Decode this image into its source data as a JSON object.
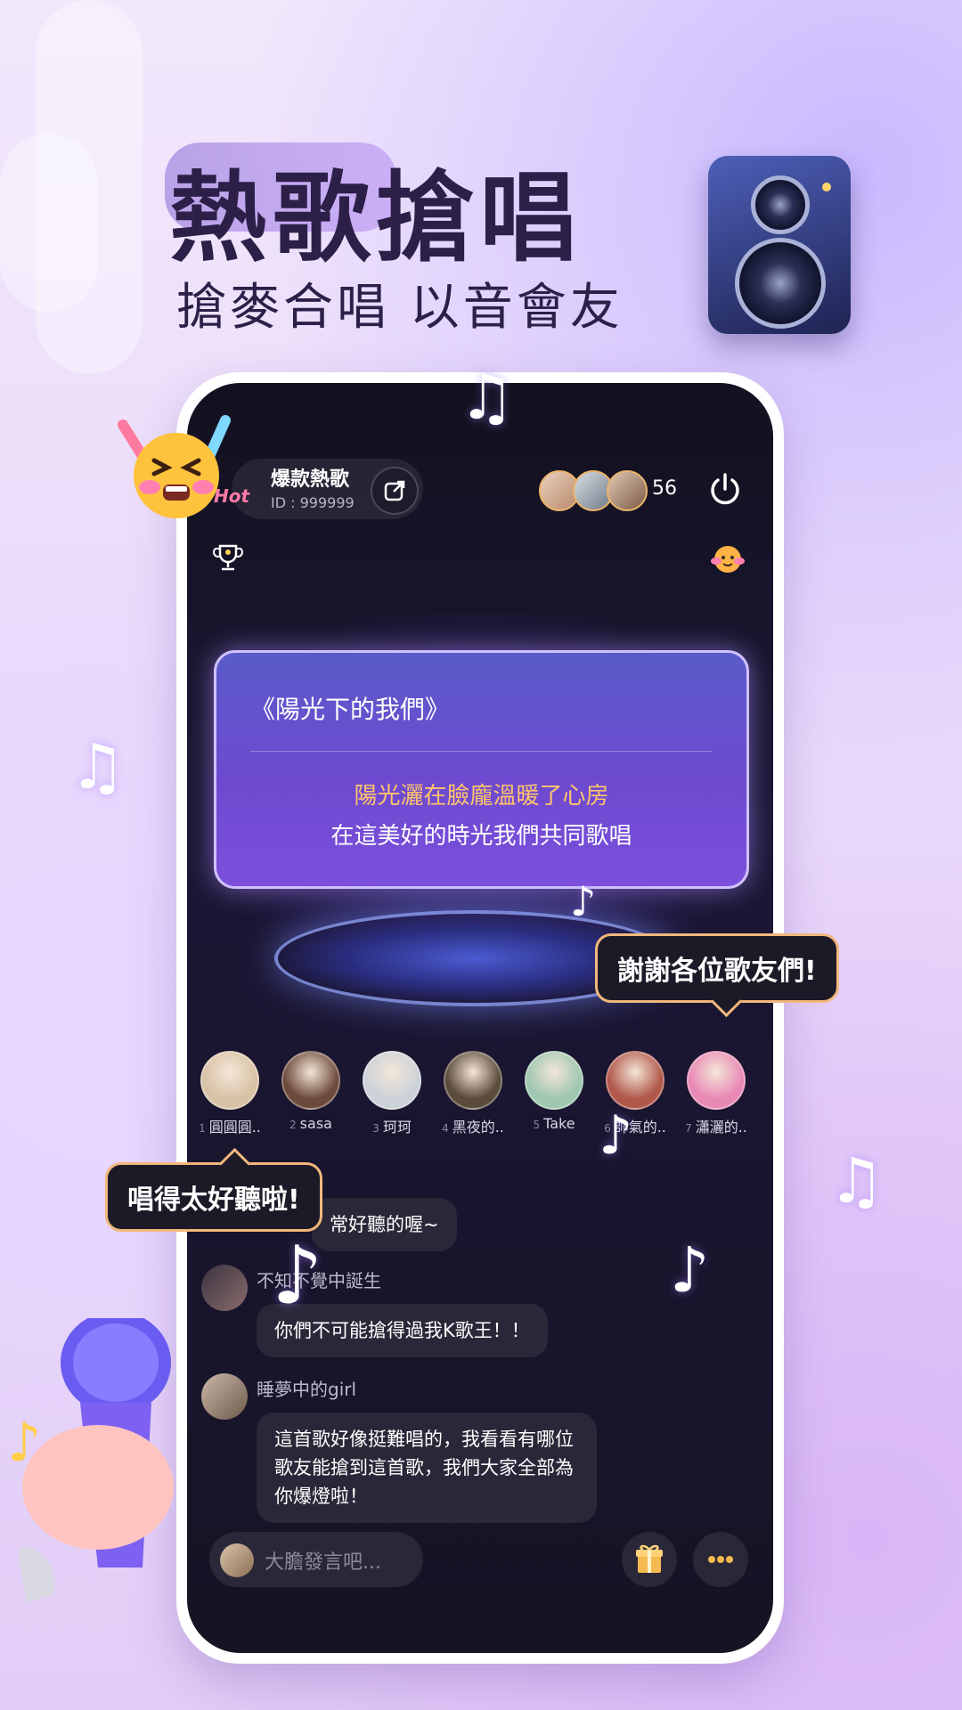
{
  "promo": {
    "headline": "熱歌搶唱",
    "subheadline": "搶麥合唱 以音會友"
  },
  "room": {
    "logo_text": "Hot",
    "title": "爆款熱歌",
    "id_text": "ID : 999999",
    "online_count": "56"
  },
  "lyrics": {
    "song_title": "《陽光下的我們》",
    "line_current": "陽光灑在臉龐溫暖了心房",
    "line_next": "在這美好的時光我們共同歌唱"
  },
  "mic_seats": [
    {
      "num": "1",
      "name": "圓圓圓..",
      "color": "#d8c2a6"
    },
    {
      "num": "2",
      "name": "sasa",
      "color": "#6d4b3c"
    },
    {
      "num": "3",
      "name": "珂珂",
      "color": "#ccd2d8"
    },
    {
      "num": "4",
      "name": "黑夜的..",
      "color": "#5a4b3b"
    },
    {
      "num": "5",
      "name": "Take",
      "color": "#9fc7b1"
    },
    {
      "num": "6",
      "name": "帥氣的..",
      "color": "#b0584a"
    },
    {
      "num": "7",
      "name": "瀟灑的..",
      "color": "#e889b5"
    }
  ],
  "chat": [
    {
      "name": "",
      "text": "常好聽的喔~"
    },
    {
      "name": "不知不覺中誕生",
      "text": "你們不可能搶得過我K歌王！！"
    },
    {
      "name": "睡夢中的girl",
      "text": "這首歌好像挺難唱的，我看看有哪位歌友能搶到這首歌，我們大家全部為你爆燈啦！"
    }
  ],
  "input": {
    "placeholder": "大膽發言吧..."
  },
  "callouts": {
    "right": "謝謝各位歌友們!",
    "left": "唱得太好聽啦!"
  },
  "icons": [
    "share-icon",
    "power-icon",
    "trophy-icon",
    "gift-icon",
    "more-icon",
    "music-note-icon",
    "speaker-icon",
    "microphone-icon",
    "emoji-icon"
  ],
  "colors": {
    "accent_gold": "#f1b77c",
    "lyric_highlight": "#ffc46b",
    "card_purple": "#6d4ad0",
    "screen_dark": "#13111f"
  }
}
